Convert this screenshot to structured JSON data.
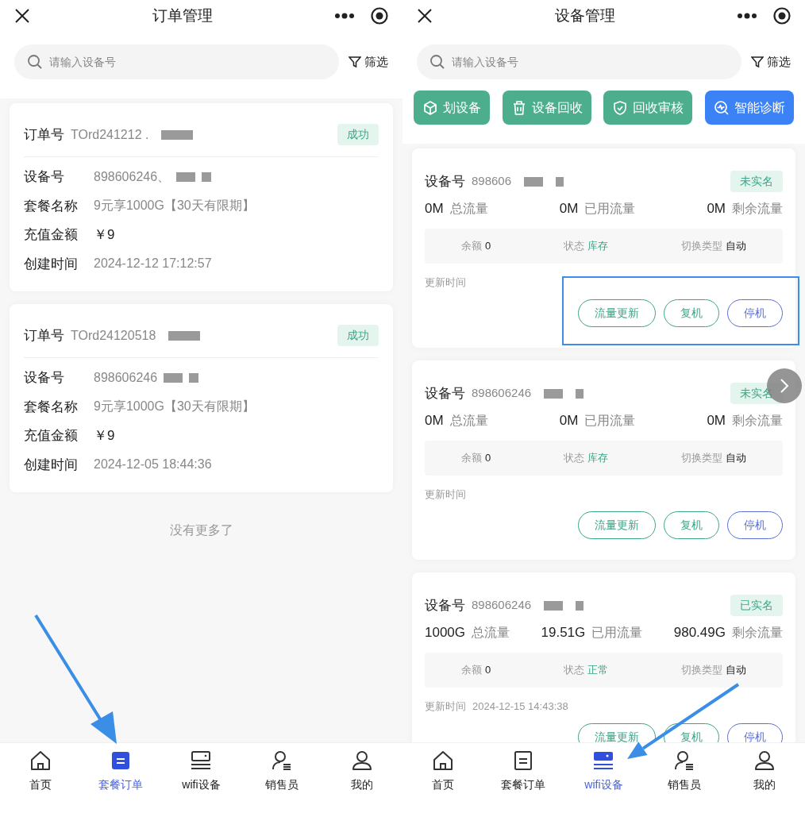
{
  "screens": [
    {
      "kind": "orders",
      "title": "订单管理",
      "search": {
        "placeholder": "请输入设备号"
      },
      "filter": "筛选",
      "orders": [
        {
          "order_label": "订单号",
          "order_no": "TOrd241212 .",
          "status": "成功",
          "fields": [
            {
              "label": "设备号",
              "value": "898606246、",
              "kind": "muted"
            },
            {
              "label": "套餐名称",
              "value": "9元享1000G【30天有限期】",
              "kind": "muted"
            },
            {
              "label": "充值金额",
              "value": "￥9",
              "kind": "amount"
            },
            {
              "label": "创建时间",
              "value": "2024-12-12 17:12:57",
              "kind": "muted"
            }
          ]
        },
        {
          "order_label": "订单号",
          "order_no": "TOrd24120518",
          "status": "成功",
          "fields": [
            {
              "label": "设备号",
              "value": "898606246",
              "kind": "muted"
            },
            {
              "label": "套餐名称",
              "value": "9元享1000G【30天有限期】",
              "kind": "muted"
            },
            {
              "label": "充值金额",
              "value": "￥9",
              "kind": "amount"
            },
            {
              "label": "创建时间",
              "value": "2024-12-05 18:44:36",
              "kind": "muted"
            }
          ]
        }
      ],
      "footer_note": "没有更多了",
      "nav": [
        {
          "label": "首页",
          "selected": false
        },
        {
          "label": "套餐订单",
          "selected": true
        },
        {
          "label": "wifi设备",
          "selected": false
        },
        {
          "label": "销售员",
          "selected": false
        },
        {
          "label": "我的",
          "selected": false
        }
      ]
    },
    {
      "kind": "devices",
      "title": "设备管理",
      "search": {
        "placeholder": "请输入设备号"
      },
      "filter": "筛选",
      "actions": [
        {
          "label": "划设备",
          "color": "#4cae8c"
        },
        {
          "label": "设备回收",
          "color": "#4cae8c"
        },
        {
          "label": "回收审核",
          "color": "#4cae8c"
        },
        {
          "label": "智能诊断",
          "color": "#3b82f6"
        }
      ],
      "devices": [
        {
          "label": "设备号",
          "number": "898606",
          "tag": "未实名",
          "stats": [
            {
              "value": "0M",
              "label": "总流量"
            },
            {
              "value": "0M",
              "label": "已用流量"
            },
            {
              "value": "0M",
              "label": "剩余流量"
            }
          ],
          "info": [
            {
              "label": "余额",
              "value": "0",
              "kind": "plain"
            },
            {
              "label": "状态",
              "value": "库存",
              "kind": "status"
            },
            {
              "label": "切换类型",
              "value": "自动",
              "kind": "plain"
            }
          ],
          "update_label": "更新时间",
          "buttons": [
            {
              "label": "流量更新",
              "color": "#3aa688"
            },
            {
              "label": "复机",
              "color": "#3aa688"
            },
            {
              "label": "停机",
              "color": "#5b6fd6"
            }
          ]
        },
        {
          "label": "设备号",
          "number": "898606246",
          "tag": "未实名",
          "stats": [
            {
              "value": "0M",
              "label": "总流量"
            },
            {
              "value": "0M",
              "label": "已用流量"
            },
            {
              "value": "0M",
              "label": "剩余流量"
            }
          ],
          "info": [
            {
              "label": "余额",
              "value": "0",
              "kind": "plain"
            },
            {
              "label": "状态",
              "value": "库存",
              "kind": "status"
            },
            {
              "label": "切换类型",
              "value": "自动",
              "kind": "plain"
            }
          ],
          "update_label": "更新时间",
          "buttons": [
            {
              "label": "流量更新",
              "color": "#3aa688"
            },
            {
              "label": "复机",
              "color": "#3aa688"
            },
            {
              "label": "停机",
              "color": "#5b6fd6"
            }
          ]
        },
        {
          "label": "设备号",
          "number": "898606246",
          "tag": "已实名",
          "stats": [
            {
              "value": "1000G",
              "label": "总流量"
            },
            {
              "value": "19.51G",
              "label": "已用流量"
            },
            {
              "value": "980.49G",
              "label": "剩余流量"
            }
          ],
          "info": [
            {
              "label": "余额",
              "value": "0",
              "kind": "plain"
            },
            {
              "label": "状态",
              "value": "正常",
              "kind": "status"
            },
            {
              "label": "切换类型",
              "value": "自动",
              "kind": "plain"
            }
          ],
          "update_label": "更新时间",
          "update_time": "2024-12-15 14:43:38",
          "buttons": [
            {
              "label": "流量更新",
              "color": "#3aa688"
            },
            {
              "label": "复机",
              "color": "#3aa688"
            },
            {
              "label": "停机",
              "color": "#5b6fd6"
            }
          ]
        }
      ],
      "nav": [
        {
          "label": "首页",
          "selected": false
        },
        {
          "label": "套餐订单",
          "selected": false
        },
        {
          "label": "wifi设备",
          "selected": true
        },
        {
          "label": "销售员",
          "selected": false
        },
        {
          "label": "我的",
          "selected": false
        }
      ]
    }
  ]
}
